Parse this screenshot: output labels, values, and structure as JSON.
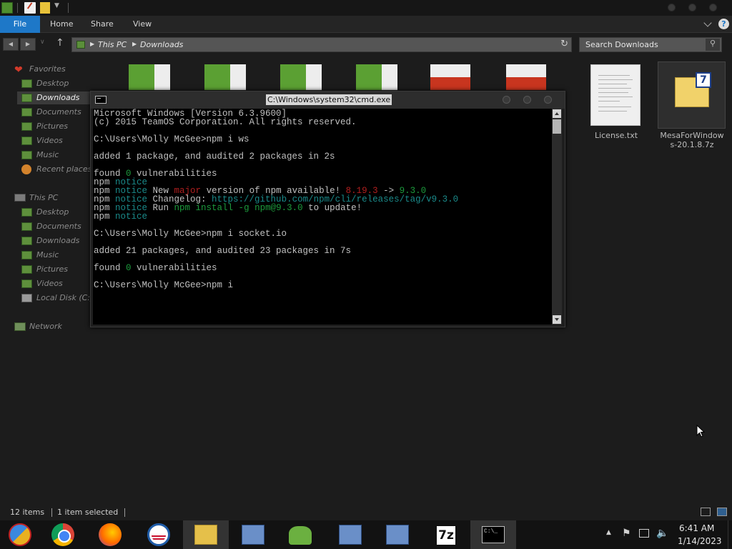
{
  "ribbon": {
    "file": "File",
    "home": "Home",
    "share": "Share",
    "view": "View",
    "help": "?"
  },
  "address": {
    "pc": "This PC",
    "folder": "Downloads"
  },
  "search": {
    "placeholder": "Search Downloads"
  },
  "sidebar": {
    "favorites": "Favorites",
    "fav_items": [
      "Desktop",
      "Downloads",
      "Documents",
      "Pictures",
      "Videos",
      "Music",
      "Recent places"
    ],
    "this_pc": "This PC",
    "pc_items": [
      "Desktop",
      "Documents",
      "Downloads",
      "Music",
      "Pictures",
      "Videos",
      "Local Disk (C:)"
    ],
    "network": "Network"
  },
  "files": {
    "license": "License.txt",
    "mesa_line1": "MesaForWindow",
    "mesa_line2": "s-20.1.8.7z"
  },
  "cmd": {
    "title": "C:\\Windows\\system32\\cmd.exe",
    "lines": [
      "Microsoft Windows [Version 6.3.9600]",
      "(c) 2015 TeamOS Corporation. All rights reserved.",
      "",
      "C:\\Users\\Molly McGee>npm i ws",
      "",
      "added 1 package, and audited 2 packages in 2s",
      "",
      "found ",
      "0",
      " vulnerabilities",
      "npm ",
      "notice",
      "npm ",
      "notice",
      " New ",
      "major",
      " version of npm available! ",
      "8.19.3",
      " -> ",
      "9.3.0",
      "npm ",
      "notice",
      " Changelog: ",
      "https://github.com/npm/cli/releases/tag/v9.3.0",
      "npm ",
      "notice",
      " Run ",
      "npm install -g npm@9.3.0",
      " to update!",
      "npm ",
      "notice",
      "",
      "C:\\Users\\Molly McGee>npm i socket.io",
      "",
      "added 21 packages, and audited 23 packages in 7s",
      "",
      "found ",
      "0",
      " vulnerabilities",
      "",
      "C:\\Users\\Molly McGee>npm i"
    ]
  },
  "status": {
    "items": "12 items",
    "selected": "1 item selected"
  },
  "taskbar": {
    "seven_z": "7z",
    "cmd_label": "C:\\_"
  },
  "clock": {
    "time": "6:41 AM",
    "date": "1/14/2023"
  }
}
